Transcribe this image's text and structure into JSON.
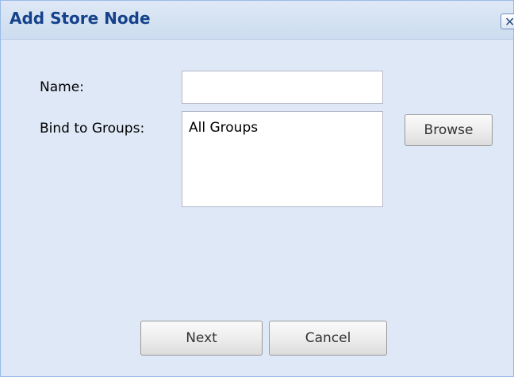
{
  "dialog": {
    "title": "Add Store Node",
    "close_glyph": "✕"
  },
  "form": {
    "name_label": "Name:",
    "name_value": "",
    "groups_label": "Bind to Groups:",
    "groups_value": "All Groups",
    "browse_label": "Browse"
  },
  "footer": {
    "next_label": "Next",
    "cancel_label": "Cancel"
  },
  "colors": {
    "title_text": "#15428b",
    "panel_bg": "#dfe8f6",
    "border": "#99bbe8"
  }
}
